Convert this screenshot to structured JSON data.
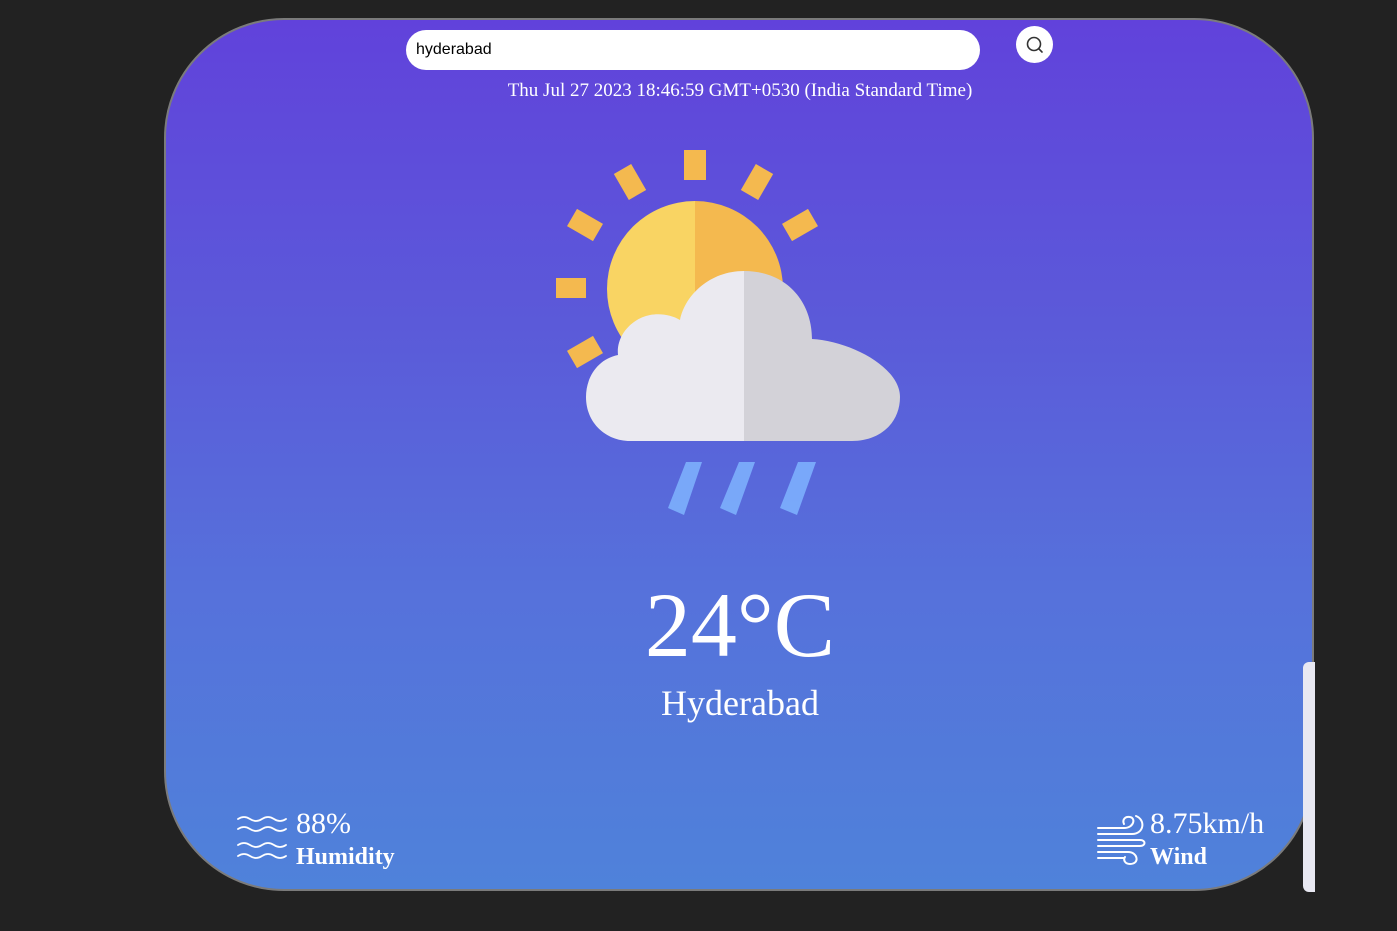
{
  "search": {
    "value": "hyderabad",
    "placeholder": "enter city name"
  },
  "datetime": "Thu Jul 27 2023 18:46:59 GMT+0530 (India Standard Time)",
  "weather": {
    "icon": "sun-cloud-rain-icon",
    "temperature": "24°C",
    "city": "Hyderabad"
  },
  "humidity": {
    "icon": "humidity-waves-icon",
    "value": "88%",
    "label": "Humidity"
  },
  "wind": {
    "icon": "wind-icon",
    "value": "8.75km/h",
    "label": "Wind"
  },
  "colors": {
    "page_background": "#222222",
    "card_gradient_top": "#6142db",
    "card_gradient_bottom": "#4f82da",
    "text": "#ffffff",
    "sun_left": "#f9d463",
    "sun_right": "#f4b94f",
    "cloud_left": "#ebeaf0",
    "cloud_right": "#d3d2d8",
    "rain": "#7fb4ff"
  }
}
